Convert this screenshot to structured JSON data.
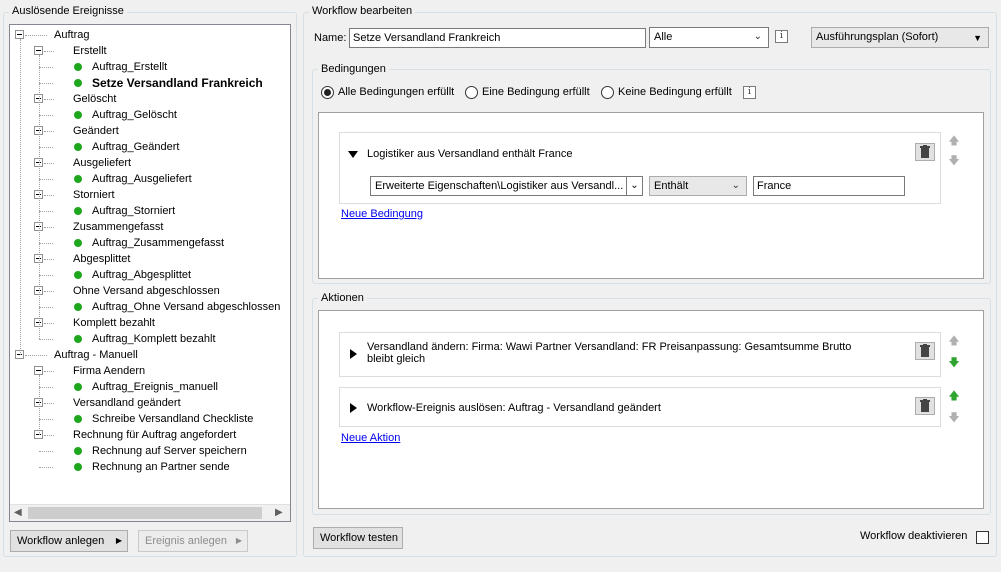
{
  "left_panel": {
    "title": "Auslösende Ereignisse",
    "tree": [
      {
        "label": "Auftrag",
        "level": 0
      },
      {
        "label": "Erstellt",
        "level": 1
      },
      {
        "label": "Auftrag_Erstellt",
        "level": 2
      },
      {
        "label": "Setze Versandland Frankreich",
        "level": 2,
        "selected": true
      },
      {
        "label": "Gelöscht",
        "level": 1
      },
      {
        "label": "Auftrag_Gelöscht",
        "level": 2
      },
      {
        "label": "Geändert",
        "level": 1
      },
      {
        "label": "Auftrag_Geändert",
        "level": 2
      },
      {
        "label": "Ausgeliefert",
        "level": 1
      },
      {
        "label": "Auftrag_Ausgeliefert",
        "level": 2
      },
      {
        "label": "Storniert",
        "level": 1
      },
      {
        "label": "Auftrag_Storniert",
        "level": 2
      },
      {
        "label": "Zusammengefasst",
        "level": 1
      },
      {
        "label": "Auftrag_Zusammengefasst",
        "level": 2
      },
      {
        "label": "Abgesplittet",
        "level": 1
      },
      {
        "label": "Auftrag_Abgesplittet",
        "level": 2
      },
      {
        "label": "Ohne Versand abgeschlossen",
        "level": 1
      },
      {
        "label": "Auftrag_Ohne Versand abgeschlossen",
        "level": 2
      },
      {
        "label": "Komplett bezahlt",
        "level": 1
      },
      {
        "label": "Auftrag_Komplett bezahlt",
        "level": 2
      },
      {
        "label": "Auftrag - Manuell",
        "level": 0
      },
      {
        "label": "Firma Aendern",
        "level": 1
      },
      {
        "label": "Auftrag_Ereignis_manuell",
        "level": 2
      },
      {
        "label": "Versandland geändert",
        "level": 1
      },
      {
        "label": "Schreibe Versandland Checkliste",
        "level": 2
      },
      {
        "label": "Rechnung für Auftrag angefordert",
        "level": 1
      },
      {
        "label": "Rechnung auf Server speichern",
        "level": 2
      },
      {
        "label": "Rechnung an Partner sende",
        "level": 2
      }
    ],
    "btn_workflow_anlegen": "Workflow anlegen",
    "btn_ereignis_anlegen": "Ereignis anlegen"
  },
  "right_panel": {
    "title": "Workflow bearbeiten",
    "name_label": "Name:",
    "name_value": "Setze Versandland Frankreich",
    "filter_value": "Alle",
    "plan_value": "Ausführungsplan (Sofort)",
    "conditions": {
      "title": "Bedingungen",
      "radio_all": "Alle Bedingungen erfüllt",
      "radio_one": "Eine Bedingung erfüllt",
      "radio_none": "Keine Bedingung erfüllt",
      "condition_title": "Logistiker aus Versandland  enthält France",
      "property_value": "Erweiterte Eigenschaften\\Logistiker aus Versandl...",
      "operator_value": "Enthält",
      "value": "France",
      "new_condition": "Neue Bedingung"
    },
    "actions": {
      "title": "Aktionen",
      "action1_line1": "Versandland ändern: Firma: Wawi Partner Versandland: FR Preisanpassung: Gesamtsumme Brutto",
      "action1_line2": "bleibt gleich",
      "action2": "Workflow-Ereignis auslösen: Auftrag - Versandland geändert",
      "new_action": "Neue Aktion"
    },
    "btn_test": "Workflow testen",
    "deactivate_label": "Workflow deaktivieren"
  },
  "colors": {
    "status_green": "#1fa61f",
    "link": "#0000ee"
  },
  "icons": [
    "info-icon",
    "chevron-down-icon",
    "trash-icon",
    "arrow-up-icon",
    "arrow-down-icon",
    "expand-icon",
    "collapse-icon",
    "play-arrow-icon"
  ]
}
